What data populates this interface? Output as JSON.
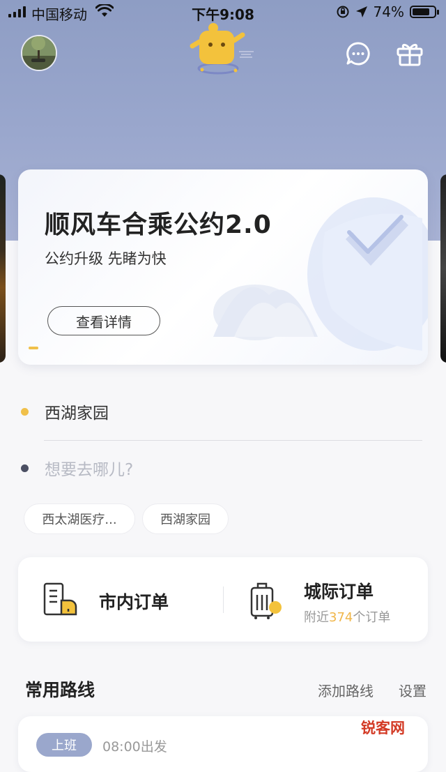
{
  "status_bar": {
    "carrier": "中国移动",
    "time": "下午9:08",
    "battery": "74%",
    "battery_level": 0.74
  },
  "header": {
    "avatar_icon": "user-avatar",
    "mascot_icon": "mascot-logo",
    "message_icon": "message-bubble-icon",
    "gift_icon": "gift-icon"
  },
  "banner": {
    "title": "顺风车合乘公约2.0",
    "subtitle": "公约升级 先睹为快",
    "button": "查看详情"
  },
  "address": {
    "from": "西湖家园",
    "to_placeholder": "想要去哪儿?",
    "chips": [
      "西太湖医疗...",
      "西湖家园"
    ],
    "from_dot_color": "#f0c04a",
    "to_dot_color": "#4b4f63"
  },
  "orders": {
    "city": {
      "title": "市内订单"
    },
    "intercity": {
      "title": "城际订单",
      "sub_prefix": "附近",
      "count": "374",
      "sub_suffix": "个订单"
    },
    "accent": "#f0b64a"
  },
  "routes": {
    "title": "常用路线",
    "add": "添加路线",
    "settings": "设置",
    "item": {
      "tag": "上班",
      "time": "08:00出发"
    }
  },
  "watermark": "锐客网"
}
